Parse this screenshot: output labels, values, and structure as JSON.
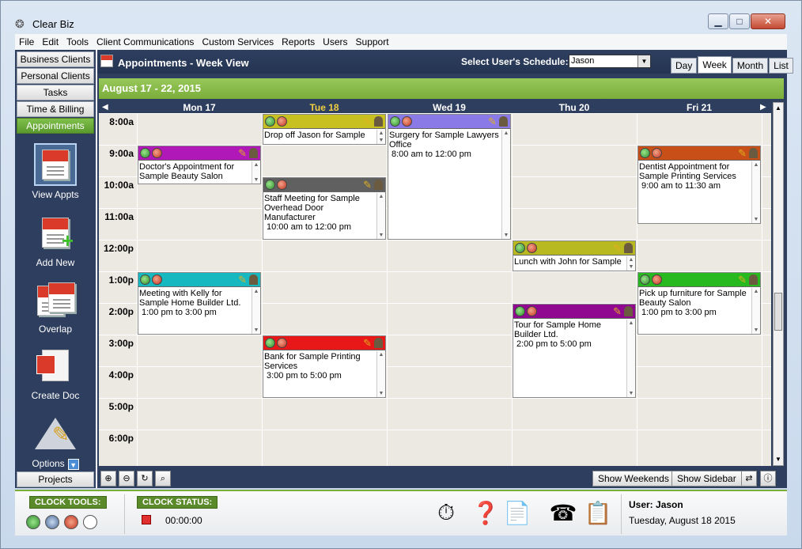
{
  "window": {
    "title": "Clear Biz",
    "controls": {
      "minimize": "▁",
      "maximize": "□",
      "close": "✕"
    }
  },
  "menu": [
    "File",
    "Edit",
    "Tools",
    "Client Communications",
    "Custom Services",
    "Reports",
    "Users",
    "Support"
  ],
  "sidebar": {
    "nav_top": [
      "Business Clients",
      "Personal Clients",
      "Tasks",
      "Time & Billing",
      "Appointments"
    ],
    "active_nav": "Appointments",
    "tools": [
      {
        "label": "View Appts",
        "icon": "calendar-icon"
      },
      {
        "label": "Add New",
        "icon": "calendar-add-icon"
      },
      {
        "label": "Overlap",
        "icon": "calendar-overlap-icon"
      },
      {
        "label": "Create Doc",
        "icon": "create-doc-icon"
      },
      {
        "label": "Options",
        "icon": "options-icon"
      }
    ],
    "nav_bottom": "Projects"
  },
  "header": {
    "title": "Appointments - Week View",
    "select_label": "Select User's Schedule:",
    "selected_user": "Jason",
    "view_tabs": [
      "Day",
      "Week",
      "Month",
      "List"
    ],
    "active_view": "Week"
  },
  "calendar": {
    "range": "August 17 - 22, 2015",
    "days": [
      "Mon 17",
      "Tue 18",
      "Wed 19",
      "Thu 20",
      "Fri 21"
    ],
    "today": "Tue 18",
    "hours": [
      "8:00a",
      "9:00a",
      "10:00a",
      "11:00a",
      "12:00p",
      "1:00p",
      "2:00p",
      "3:00p",
      "4:00p",
      "5:00p",
      "6:00p"
    ],
    "appointments": [
      {
        "day": 1,
        "start": 8.0,
        "end": 9.0,
        "color": "#c8c020",
        "title": "Drop off Jason for Sample",
        "time": ""
      },
      {
        "day": 2,
        "start": 8.0,
        "end": 12.0,
        "color": "#8a7ae8",
        "title": "Surgery for Sample Lawyers Office",
        "time": "8:00 am to 12:00 pm"
      },
      {
        "day": 0,
        "start": 9.0,
        "end": 10.25,
        "color": "#b018b8",
        "title": "Doctor's Appointment for Sample Beauty Salon",
        "time": ""
      },
      {
        "day": 4,
        "start": 9.0,
        "end": 11.5,
        "color": "#c85018",
        "title": "Dentist Appointment for Sample Printing Services",
        "time": "9:00 am to 11:30 am"
      },
      {
        "day": 1,
        "start": 10.0,
        "end": 12.0,
        "color": "#606060",
        "title": "Staff Meeting for Sample Overhead Door Manufacturer",
        "time": "10:00 am to 12:00 pm"
      },
      {
        "day": 3,
        "start": 12.0,
        "end": 13.0,
        "color": "#b8b820",
        "title": "Lunch with John for Sample",
        "time": ""
      },
      {
        "day": 0,
        "start": 13.0,
        "end": 15.0,
        "color": "#18b8c0",
        "title": "Meeting with Kelly for Sample Home Builder Ltd.",
        "time": "1:00 pm to 3:00 pm"
      },
      {
        "day": 4,
        "start": 13.0,
        "end": 15.0,
        "color": "#28b820",
        "title": "Pick up furniture for Sample Beauty Salon",
        "time": "1:00 pm to 3:00 pm"
      },
      {
        "day": 3,
        "start": 14.0,
        "end": 17.0,
        "color": "#900890",
        "title": "Tour for Sample Home Builder Ltd.",
        "time": "2:00 pm to 5:00 pm"
      },
      {
        "day": 1,
        "start": 15.0,
        "end": 17.0,
        "color": "#e81818",
        "title": "Bank for Sample Printing Services",
        "time": "3:00 pm to 5:00 pm"
      }
    ]
  },
  "toolbar": {
    "show_weekends": "Show Weekends",
    "show_sidebar": "Show Sidebar"
  },
  "status": {
    "clock_tools_label": "CLOCK TOOLS:",
    "clock_status_label": "CLOCK STATUS:",
    "clock_time": "00:00:00",
    "user_label": "User: Jason",
    "date": "Tuesday, August 18 2015"
  }
}
